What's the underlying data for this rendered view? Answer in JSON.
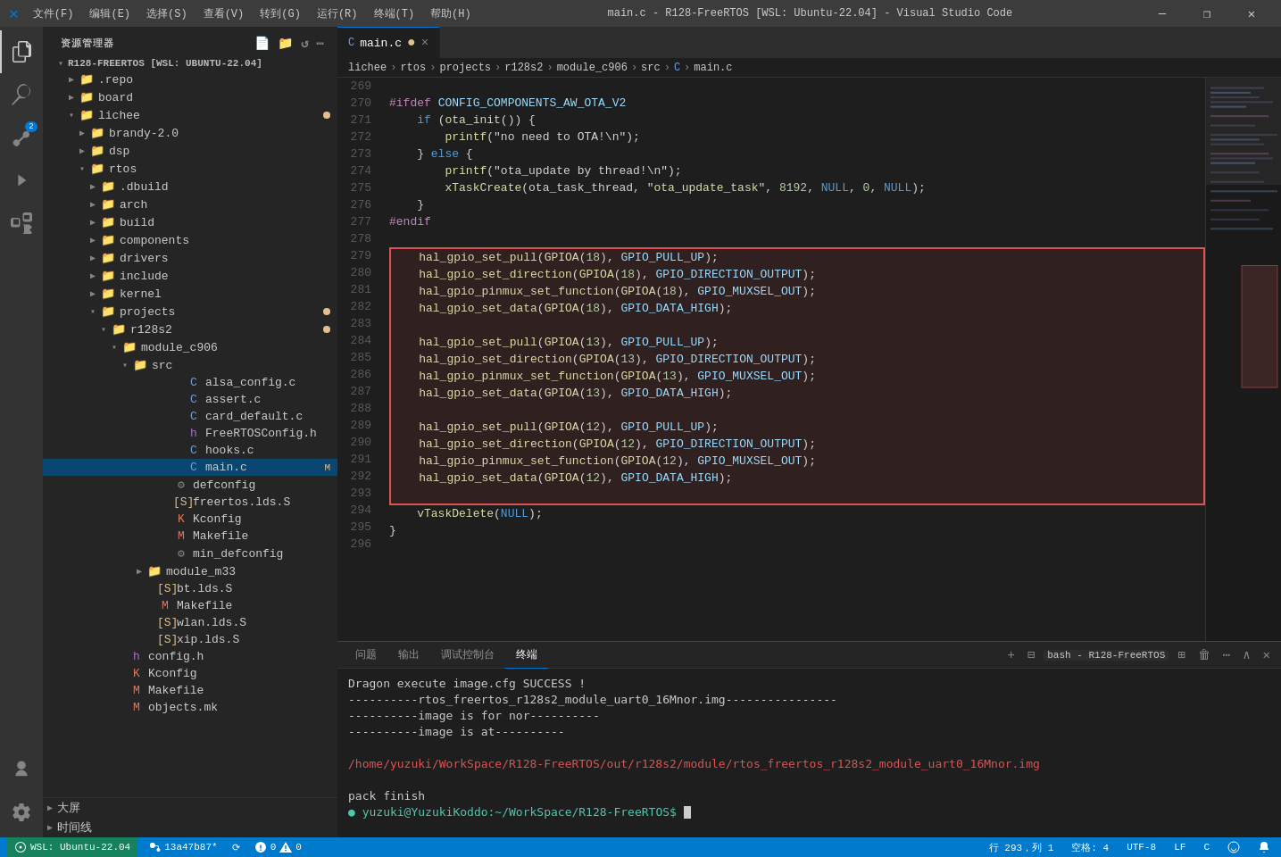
{
  "titlebar": {
    "icon": "✕",
    "menus": [
      "文件(F)",
      "编辑(E)",
      "选择(S)",
      "查看(V)",
      "转到(G)",
      "运行(R)",
      "终端(T)",
      "帮助(H)"
    ],
    "title": "main.c - R128-FreeRTOS [WSL: Ubuntu-22.04] - Visual Studio Code",
    "buttons": [
      "—",
      "❐",
      "✕"
    ]
  },
  "activity_bar": {
    "icons": [
      {
        "name": "explorer-icon",
        "symbol": "⊞",
        "active": true
      },
      {
        "name": "search-icon",
        "symbol": "🔍",
        "active": false
      },
      {
        "name": "source-control-icon",
        "symbol": "⎇",
        "badge": "2"
      },
      {
        "name": "run-icon",
        "symbol": "▶",
        "active": false
      },
      {
        "name": "extensions-icon",
        "symbol": "⊟",
        "active": false
      },
      {
        "name": "remote-explorer-icon",
        "symbol": "🖥",
        "active": false
      }
    ]
  },
  "sidebar": {
    "title": "资源管理器",
    "root": {
      "label": "R128-FREERTOS [WSL: UBUNTU-22.04]",
      "items": [
        {
          "id": "repo",
          "label": ".repo",
          "indent": 1,
          "type": "folder",
          "expanded": false
        },
        {
          "id": "board",
          "label": "board",
          "indent": 1,
          "type": "folder",
          "expanded": false
        },
        {
          "id": "lichee",
          "label": "lichee",
          "indent": 1,
          "type": "folder",
          "expanded": true,
          "badge": true
        },
        {
          "id": "brandy",
          "label": "brandy-2.0",
          "indent": 2,
          "type": "folder",
          "expanded": false
        },
        {
          "id": "dsp",
          "label": "dsp",
          "indent": 2,
          "type": "folder",
          "expanded": false
        },
        {
          "id": "rtos",
          "label": "rtos",
          "indent": 2,
          "type": "folder",
          "expanded": true
        },
        {
          "id": "dbuild",
          "label": ".dbuild",
          "indent": 3,
          "type": "folder",
          "expanded": false
        },
        {
          "id": "arch",
          "label": "arch",
          "indent": 3,
          "type": "folder",
          "expanded": false
        },
        {
          "id": "build",
          "label": "build",
          "indent": 3,
          "type": "folder",
          "expanded": false
        },
        {
          "id": "components",
          "label": "components",
          "indent": 3,
          "type": "folder",
          "expanded": false
        },
        {
          "id": "drivers",
          "label": "drivers",
          "indent": 3,
          "type": "folder",
          "expanded": false
        },
        {
          "id": "include",
          "label": "include",
          "indent": 3,
          "type": "folder",
          "expanded": false
        },
        {
          "id": "kernel",
          "label": "kernel",
          "indent": 3,
          "type": "folder",
          "expanded": false
        },
        {
          "id": "projects",
          "label": "projects",
          "indent": 3,
          "type": "folder",
          "expanded": true,
          "badge": true
        },
        {
          "id": "r128s2",
          "label": "r128s2",
          "indent": 4,
          "type": "folder",
          "expanded": true,
          "badge": true
        },
        {
          "id": "module_c906",
          "label": "module_c906",
          "indent": 5,
          "type": "folder",
          "expanded": true
        },
        {
          "id": "src",
          "label": "src",
          "indent": 6,
          "type": "folder",
          "expanded": true
        },
        {
          "id": "alsa_config",
          "label": "alsa_config.c",
          "indent": 7,
          "type": "c-file"
        },
        {
          "id": "assert",
          "label": "assert.c",
          "indent": 7,
          "type": "c-file"
        },
        {
          "id": "card_default",
          "label": "card_default.c",
          "indent": 7,
          "type": "c-file"
        },
        {
          "id": "FreeRTOSConfig",
          "label": "FreeRTOSConfig.h",
          "indent": 7,
          "type": "h-file"
        },
        {
          "id": "hooks",
          "label": "hooks.c",
          "indent": 7,
          "type": "c-file"
        },
        {
          "id": "main",
          "label": "main.c",
          "indent": 7,
          "type": "c-file",
          "modified": true,
          "selected": true
        },
        {
          "id": "defconfig",
          "label": "defconfig",
          "indent": 6,
          "type": "config-file"
        },
        {
          "id": "freertos_lds",
          "label": "freertos.lds.S",
          "indent": 6,
          "type": "s-file"
        },
        {
          "id": "Kconfig",
          "label": "Kconfig",
          "indent": 6,
          "type": "k-file"
        },
        {
          "id": "Makefile",
          "label": "Makefile",
          "indent": 6,
          "type": "make-file"
        },
        {
          "id": "min_defconfig",
          "label": "min_defconfig",
          "indent": 6,
          "type": "config-file"
        },
        {
          "id": "module_m33",
          "label": "module_m33",
          "indent": 4,
          "type": "folder",
          "expanded": false
        },
        {
          "id": "bt_lds",
          "label": "bt.lds.S",
          "indent": 5,
          "type": "s-file"
        },
        {
          "id": "Makefile2",
          "label": "Makefile",
          "indent": 5,
          "type": "make-file"
        },
        {
          "id": "wlan_lds",
          "label": "wlan.lds.S",
          "indent": 5,
          "type": "s-file"
        },
        {
          "id": "xip_lds",
          "label": "xip.lds.S",
          "indent": 5,
          "type": "s-file"
        },
        {
          "id": "config_h",
          "label": "config.h",
          "indent": 4,
          "type": "h-file"
        },
        {
          "id": "Kconfig2",
          "label": "Kconfig",
          "indent": 4,
          "type": "k-file"
        },
        {
          "id": "Makefile3",
          "label": "Makefile",
          "indent": 4,
          "type": "make-file"
        },
        {
          "id": "objects_mk",
          "label": "objects.mk",
          "indent": 4,
          "type": "mk-file"
        }
      ]
    },
    "bottom_items": [
      {
        "label": "大屏",
        "expanded": false
      },
      {
        "label": "时间线",
        "expanded": false
      }
    ]
  },
  "editor": {
    "tabs": [
      {
        "label": "main.c",
        "active": true,
        "modified": true,
        "closeable": true
      }
    ],
    "breadcrumb": [
      "lichee",
      "rtos",
      "projects",
      "r128s2",
      "module_c906",
      "src",
      "C",
      "main.c"
    ],
    "lines": [
      {
        "num": 269,
        "content": "",
        "highlight": false
      },
      {
        "num": 270,
        "content": "#ifdef CONFIG_COMPONENTS_AW_OTA_V2",
        "highlight": false
      },
      {
        "num": 271,
        "content": "    if (ota_init()) {",
        "highlight": false
      },
      {
        "num": 272,
        "content": "        printf(\"no need to OTA!\\n\");",
        "highlight": false
      },
      {
        "num": 273,
        "content": "    } else {",
        "highlight": false
      },
      {
        "num": 274,
        "content": "        printf(\"ota_update by thread!\\n\");",
        "highlight": false
      },
      {
        "num": 275,
        "content": "        xTaskCreate(ota_task_thread, \"ota_update_task\", 8192, NULL, 0, NULL);",
        "highlight": false
      },
      {
        "num": 276,
        "content": "    }",
        "highlight": false
      },
      {
        "num": 277,
        "content": "#endif",
        "highlight": false
      },
      {
        "num": 278,
        "content": "",
        "highlight": false
      },
      {
        "num": 279,
        "content": "    hal_gpio_set_pull(GPIOA(18), GPIO_PULL_UP);",
        "highlight": true,
        "pos": "top"
      },
      {
        "num": 280,
        "content": "    hal_gpio_set_direction(GPIOA(18), GPIO_DIRECTION_OUTPUT);",
        "highlight": true,
        "pos": "mid"
      },
      {
        "num": 281,
        "content": "    hal_gpio_pinmux_set_function(GPIOA(18), GPIO_MUXSEL_OUT);",
        "highlight": true,
        "pos": "mid"
      },
      {
        "num": 282,
        "content": "    hal_gpio_set_data(GPIOA(18), GPIO_DATA_HIGH);",
        "highlight": true,
        "pos": "mid"
      },
      {
        "num": 283,
        "content": "",
        "highlight": true,
        "pos": "mid"
      },
      {
        "num": 284,
        "content": "    hal_gpio_set_pull(GPIOA(13), GPIO_PULL_UP);",
        "highlight": true,
        "pos": "mid"
      },
      {
        "num": 285,
        "content": "    hal_gpio_set_direction(GPIOA(13), GPIO_DIRECTION_OUTPUT);",
        "highlight": true,
        "pos": "mid"
      },
      {
        "num": 286,
        "content": "    hal_gpio_pinmux_set_function(GPIOA(13), GPIO_MUXSEL_OUT);",
        "highlight": true,
        "pos": "mid"
      },
      {
        "num": 287,
        "content": "    hal_gpio_set_data(GPIOA(13), GPIO_DATA_HIGH);",
        "highlight": true,
        "pos": "mid"
      },
      {
        "num": 288,
        "content": "",
        "highlight": true,
        "pos": "mid"
      },
      {
        "num": 289,
        "content": "    hal_gpio_set_pull(GPIOA(12), GPIO_PULL_UP);",
        "highlight": true,
        "pos": "mid"
      },
      {
        "num": 290,
        "content": "    hal_gpio_set_direction(GPIOA(12), GPIO_DIRECTION_OUTPUT);",
        "highlight": true,
        "pos": "mid"
      },
      {
        "num": 291,
        "content": "    hal_gpio_pinmux_set_function(GPIOA(12), GPIO_MUXSEL_OUT);",
        "highlight": true,
        "pos": "mid"
      },
      {
        "num": 292,
        "content": "    hal_gpio_set_data(GPIOA(12), GPIO_DATA_HIGH);",
        "highlight": true,
        "pos": "mid"
      },
      {
        "num": 293,
        "content": "",
        "highlight": true,
        "pos": "bot"
      },
      {
        "num": 294,
        "content": "    vTaskDelete(NULL);",
        "highlight": false
      },
      {
        "num": 295,
        "content": "}",
        "highlight": false
      },
      {
        "num": 296,
        "content": "",
        "highlight": false
      }
    ]
  },
  "panel": {
    "tabs": [
      "问题",
      "输出",
      "调试控制台",
      "终端"
    ],
    "active_tab": "终端",
    "terminal": {
      "lines": [
        {
          "text": "Dragon execute image.cfg SUCCESS !",
          "type": "normal"
        },
        {
          "text": "----------rtos_freertos_r128s2_module_uart0_16Mnor.img----------------",
          "type": "normal"
        },
        {
          "text": "----------image is for nor----------",
          "type": "normal"
        },
        {
          "text": "----------image is at----------",
          "type": "normal"
        },
        {
          "text": "",
          "type": "normal"
        },
        {
          "text": "/home/yuzuki/WorkSpace/R128-FreeRTOS/out/r128s2/module/rtos_freertos_r128s2_module_uart0_16Mnor.img",
          "type": "path"
        },
        {
          "text": "",
          "type": "normal"
        },
        {
          "text": "pack finish",
          "type": "normal"
        },
        {
          "text": "● yuzuki@YuzukiKoddo:~/WorkSpace/R128-FreeRTOS$ ",
          "type": "prompt"
        }
      ],
      "shell_label": "bash - R128-FreeRTOS"
    }
  },
  "statusbar": {
    "remote": "WSL: Ubuntu-22.04",
    "git_branch": "13a47b87*",
    "sync_icon": "⟳",
    "errors": "0",
    "warnings": "0",
    "position": "行 293，列 1",
    "spaces": "空格: 4",
    "encoding": "UTF-8",
    "line_ending": "LF",
    "language": "C"
  }
}
